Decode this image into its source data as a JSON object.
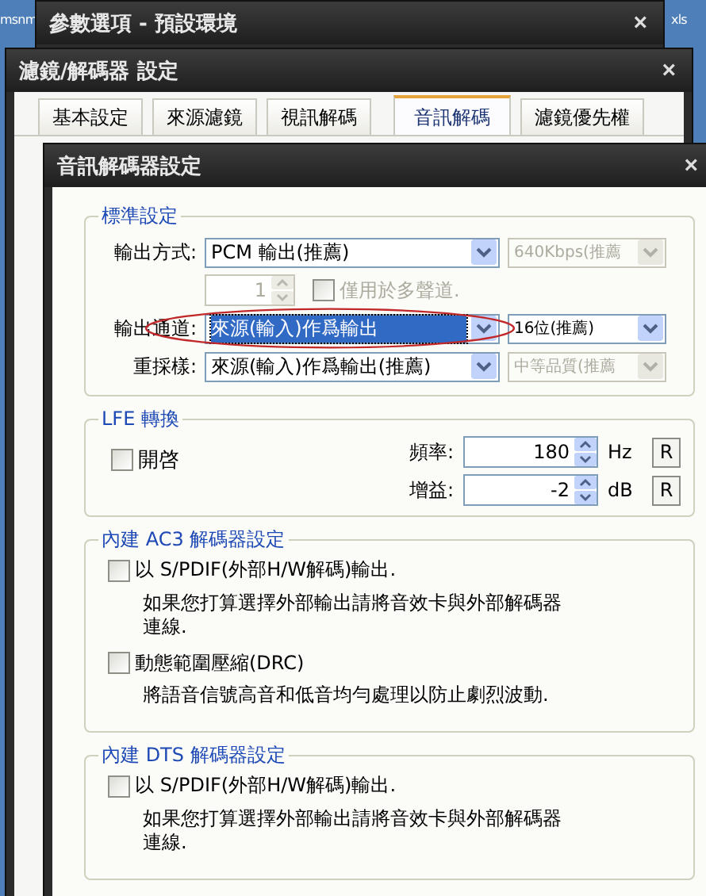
{
  "desktop_labels": [
    {
      "text": "msnm"
    },
    {
      "text": "xls"
    }
  ],
  "preferences_window": {
    "title": "參數選項 - 預設環境",
    "close": "×"
  },
  "filter_window": {
    "title": "濾鏡/解碼器 設定",
    "close": "×",
    "tabs": [
      {
        "label": "基本設定",
        "selected": false
      },
      {
        "label": "來源濾鏡",
        "selected": false
      },
      {
        "label": "視訊解碼",
        "selected": false
      },
      {
        "label": "音訊解碼",
        "selected": true
      },
      {
        "label": "濾鏡優先權",
        "selected": false
      }
    ]
  },
  "audio_window": {
    "title": "音訊解碼器設定",
    "close": "×",
    "standard": {
      "title": "標準設定",
      "rows": [
        {
          "kind": "select",
          "label": "輸出方式:",
          "main": {
            "value": "PCM 輸出(推薦)",
            "disabled": false,
            "focused": false
          },
          "side": {
            "value": "640Kbps(推薦",
            "disabled": true
          },
          "circled": false
        },
        {
          "kind": "spin",
          "spin": {
            "value": "1",
            "disabled": true
          },
          "check": {
            "label": "僅用於多聲道.",
            "checked": false,
            "disabled": true
          }
        },
        {
          "kind": "select",
          "label": "輸出通道:",
          "main": {
            "value": "來源(輸入)作爲輸出",
            "disabled": false,
            "focused": true
          },
          "side": {
            "value": "16位(推薦)",
            "disabled": false
          },
          "circled": true
        },
        {
          "kind": "select",
          "label": "重採樣:",
          "main": {
            "value": "來源(輸入)作爲輸出(推薦)",
            "disabled": false,
            "focused": false
          },
          "side": {
            "value": "中等品質(推薦",
            "disabled": true
          },
          "circled": false
        }
      ]
    },
    "lfe": {
      "title": "LFE 轉換",
      "enable": {
        "label": "開啓",
        "checked": false
      },
      "fields": [
        {
          "label": "頻率:",
          "value": "180",
          "unit": "Hz",
          "reset": "R"
        },
        {
          "label": "增益:",
          "value": "-2",
          "unit": "dB",
          "reset": "R"
        }
      ]
    },
    "decoders": [
      {
        "title": "內建 AC3 解碼器設定",
        "options": [
          {
            "label": "以 S/PDIF(外部H/W解碼)輸出.",
            "checked": false,
            "description": "如果您打算選擇外部輸出請將音效卡與外部解碼器連線."
          },
          {
            "label": "動態範圍壓縮(DRC)",
            "checked": false,
            "description": "將語音信號高音和低音均勻處理以防止劇烈波動."
          }
        ]
      },
      {
        "title": "內建 DTS 解碼器設定",
        "options": [
          {
            "label": "以 S/PDIF(外部H/W解碼)輸出.",
            "checked": false,
            "description": "如果您打算選擇外部輸出請將音效卡與外部解碼器連線."
          }
        ]
      }
    ]
  }
}
